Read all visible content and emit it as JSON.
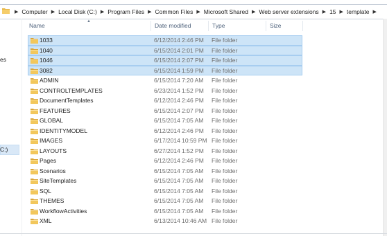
{
  "breadcrumb": [
    "Computer",
    "Local Disk (C:)",
    "Program Files",
    "Common Files",
    "Microsoft Shared",
    "Web server extensions",
    "15",
    "template"
  ],
  "nav_fragments": [
    "es",
    "C:)"
  ],
  "columns": {
    "name": "Name",
    "date_modified": "Date modified",
    "type": "Type",
    "size": "Size"
  },
  "icons": {
    "folder": "folder-icon",
    "chevron": "chevron-right-icon",
    "sort": "sort-up-icon"
  },
  "colors": {
    "folder": "#e8b84a",
    "selection": "#cde4f7",
    "selection_border": "#a7cdf0"
  },
  "files": [
    {
      "name": "1033",
      "date": "6/12/2014 2:46 PM",
      "type": "File folder",
      "selected": true
    },
    {
      "name": "1040",
      "date": "6/15/2014 2:01 PM",
      "type": "File folder",
      "selected": true
    },
    {
      "name": "1046",
      "date": "6/15/2014 2:07 PM",
      "type": "File folder",
      "selected": true
    },
    {
      "name": "3082",
      "date": "6/15/2014 1:59 PM",
      "type": "File folder",
      "selected": true
    },
    {
      "name": "ADMIN",
      "date": "6/15/2014 7:20 AM",
      "type": "File folder",
      "selected": false
    },
    {
      "name": "CONTROLTEMPLATES",
      "date": "6/23/2014 1:52 PM",
      "type": "File folder",
      "selected": false
    },
    {
      "name": "DocumentTemplates",
      "date": "6/12/2014 2:46 PM",
      "type": "File folder",
      "selected": false
    },
    {
      "name": "FEATURES",
      "date": "6/15/2014 2:07 PM",
      "type": "File folder",
      "selected": false
    },
    {
      "name": "GLOBAL",
      "date": "6/15/2014 7:05 AM",
      "type": "File folder",
      "selected": false
    },
    {
      "name": "IDENTITYMODEL",
      "date": "6/12/2014 2:46 PM",
      "type": "File folder",
      "selected": false
    },
    {
      "name": "IMAGES",
      "date": "6/17/2014 10:59 PM",
      "type": "File folder",
      "selected": false
    },
    {
      "name": "LAYOUTS",
      "date": "6/27/2014 1:52 PM",
      "type": "File folder",
      "selected": false
    },
    {
      "name": "Pages",
      "date": "6/12/2014 2:46 PM",
      "type": "File folder",
      "selected": false
    },
    {
      "name": "Scenarios",
      "date": "6/15/2014 7:05 AM",
      "type": "File folder",
      "selected": false
    },
    {
      "name": "SiteTemplates",
      "date": "6/15/2014 7:05 AM",
      "type": "File folder",
      "selected": false
    },
    {
      "name": "SQL",
      "date": "6/15/2014 7:05 AM",
      "type": "File folder",
      "selected": false
    },
    {
      "name": "THEMES",
      "date": "6/15/2014 7:05 AM",
      "type": "File folder",
      "selected": false
    },
    {
      "name": "WorkflowActivities",
      "date": "6/15/2014 7:05 AM",
      "type": "File folder",
      "selected": false
    },
    {
      "name": "XML",
      "date": "6/13/2014 10:46 AM",
      "type": "File folder",
      "selected": false
    }
  ]
}
